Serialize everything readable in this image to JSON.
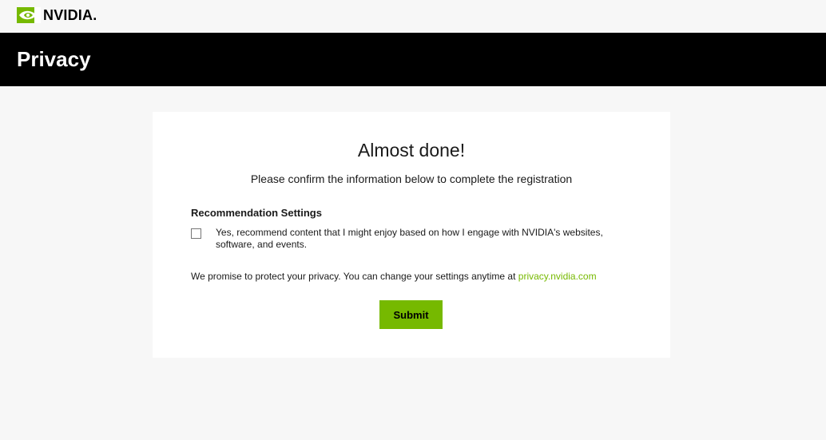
{
  "header": {
    "logo_text": "NVIDIA.",
    "logo_icon": "nvidia-eye-icon",
    "brand_color": "#76b900"
  },
  "banner": {
    "title": "Privacy"
  },
  "card": {
    "title": "Almost done!",
    "subtitle": "Please confirm the information below to complete the registration",
    "section_title": "Recommendation Settings",
    "checkbox_label": "Yes, recommend content that I might enjoy based on how I engage with NVIDIA's websites, software, and events.",
    "checkbox_checked": false,
    "privacy_note": "We promise to protect your privacy. You can change your settings anytime at",
    "privacy_link": "privacy.nvidia.com",
    "submit_label": "Submit"
  }
}
